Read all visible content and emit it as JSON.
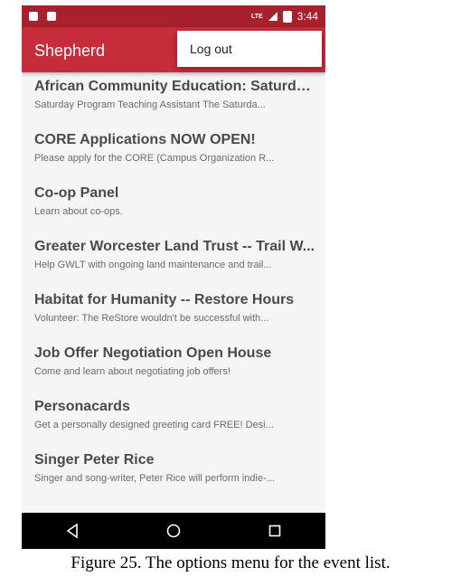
{
  "status_bar": {
    "network": "LTE",
    "time": "3:44"
  },
  "app_bar": {
    "title": "Shepherd"
  },
  "options_menu": {
    "items": [
      {
        "label": "Log out"
      }
    ]
  },
  "events": [
    {
      "title": "African Community Education: Saturday...",
      "subtitle": "Saturday Program Teaching Assistant  The Saturda..."
    },
    {
      "title": "CORE Applications NOW OPEN!",
      "subtitle": "Please apply for the CORE (Campus Organization R..."
    },
    {
      "title": "Co-op Panel",
      "subtitle": "Learn about co-ops."
    },
    {
      "title": "Greater Worcester Land Trust -- Trail W...",
      "subtitle": "Help GWLT with ongoing land maintenance and trail..."
    },
    {
      "title": "Habitat for Humanity -- Restore Hours",
      "subtitle": "Volunteer: The ReStore wouldn't be successful with..."
    },
    {
      "title": "Job Offer Negotiation Open House",
      "subtitle": "Come and learn about negotiating job offers!"
    },
    {
      "title": "Personacards",
      "subtitle": "Get a personally designed greeting card FREE!  Desi..."
    },
    {
      "title": "Singer Peter Rice",
      "subtitle": "Singer and song-writer, Peter Rice will perform indie-..."
    }
  ],
  "nav_bar": {
    "icons": [
      "back-icon",
      "home-icon",
      "recents-icon"
    ]
  },
  "caption": "Figure 25. The options menu for the event list.",
  "colors": {
    "status_bar": "#a6202d",
    "app_bar": "#c62c3a"
  }
}
